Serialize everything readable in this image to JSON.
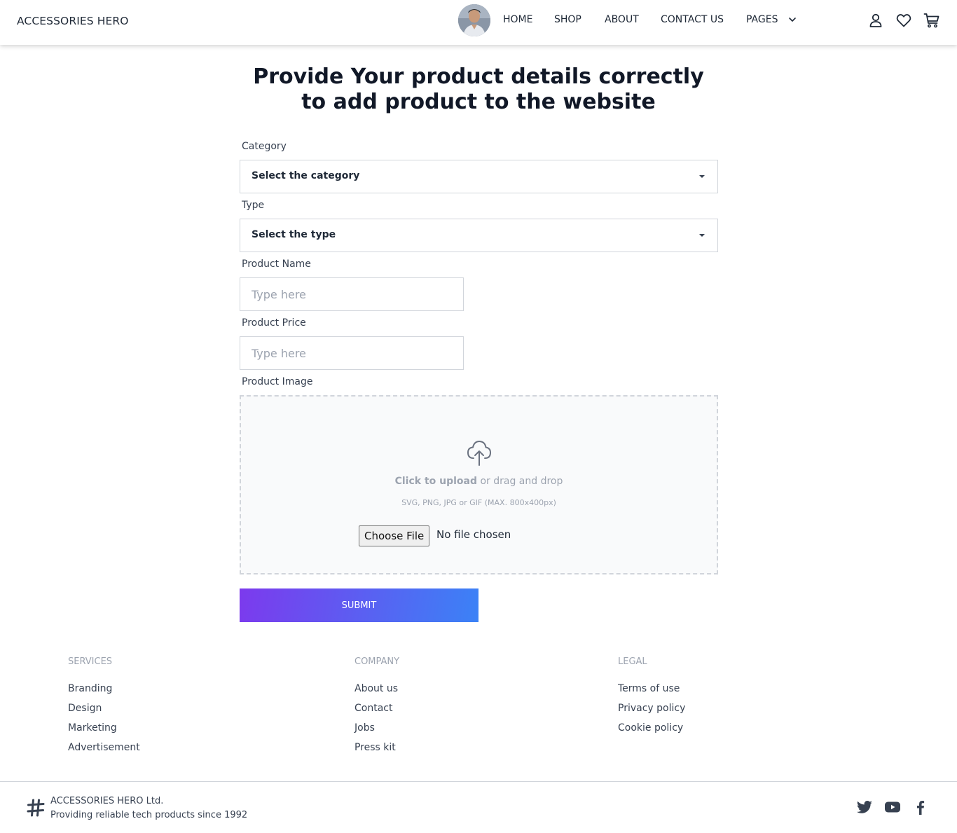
{
  "navbar": {
    "brand": "ACCESSORIES HERO",
    "links": [
      "HOME",
      "SHOP",
      "ABOUT",
      "CONTACT US",
      "PAGES"
    ],
    "icons": [
      "user-icon",
      "heart-icon",
      "cart-icon"
    ]
  },
  "heading": {
    "line1": "Provide Your product details correctly",
    "line2": "to add product to the website"
  },
  "form": {
    "category_label": "Category",
    "category_value": "Select the category",
    "type_label": "Type",
    "type_value": "Select the type",
    "name_label": "Product Name",
    "name_placeholder": "Type here",
    "price_label": "Product Price",
    "price_placeholder": "Type here",
    "image_label": "Product Image",
    "upload_click": "Click to upload",
    "upload_drag": " or drag and drop",
    "upload_hint": "SVG, PNG, JPG or GIF (MAX. 800x400px)",
    "file_button": "Choose File",
    "file_status": "No file chosen",
    "submit_label": "SUBMIT"
  },
  "footer": {
    "services": {
      "title": "SERVICES",
      "items": [
        "Branding",
        "Design",
        "Marketing",
        "Advertisement"
      ]
    },
    "company": {
      "title": "COMPANY",
      "items": [
        "About us",
        "Contact",
        "Jobs",
        "Press kit"
      ]
    },
    "legal": {
      "title": "LEGAL",
      "items": [
        "Terms of use",
        "Privacy policy",
        "Cookie policy"
      ]
    },
    "company_name": "ACCESSORIES HERO Ltd.",
    "tagline": "Providing reliable tech products since 1992",
    "social": [
      "twitter-icon",
      "youtube-icon",
      "facebook-icon"
    ]
  },
  "colors": {
    "accent_start": "#7c3aed",
    "accent_end": "#3b82f6",
    "text": "#1f2937",
    "muted": "#9ca3af"
  }
}
